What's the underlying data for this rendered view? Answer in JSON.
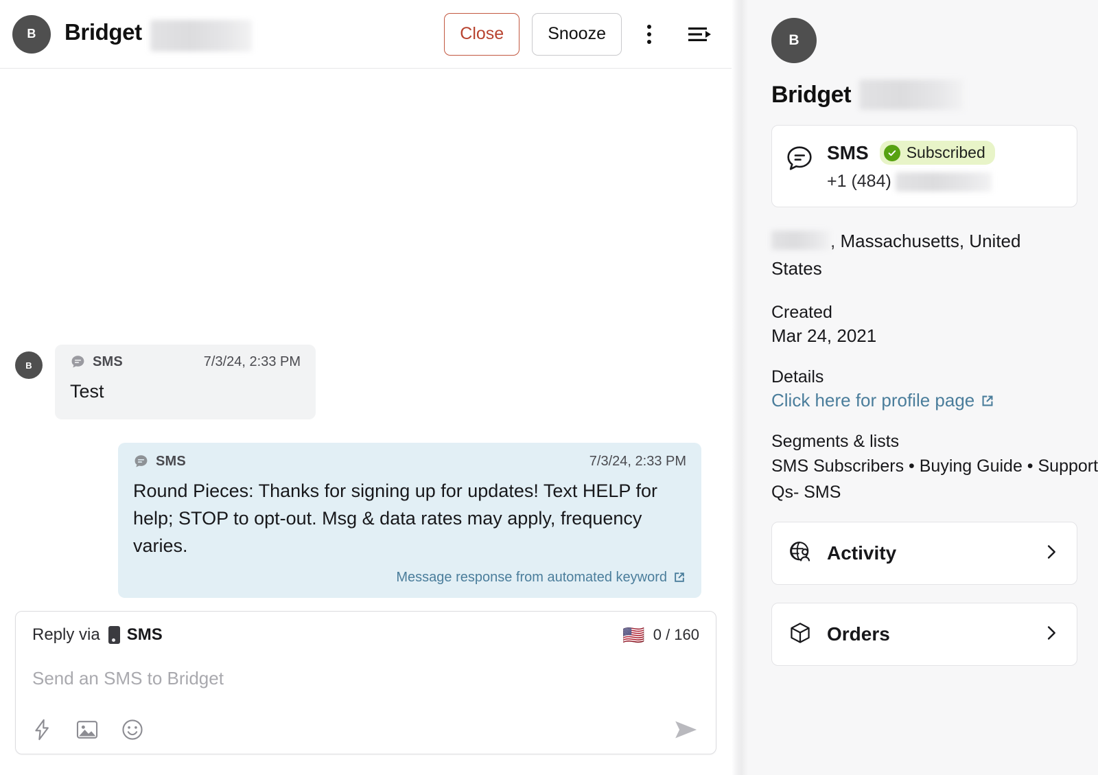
{
  "conversation_header": {
    "avatar_initial": "B",
    "contact_name": "Bridget",
    "close_label": "Close",
    "snooze_label": "Snooze"
  },
  "messages": [
    {
      "direction": "incoming",
      "avatar_initial": "B",
      "channel": "SMS",
      "timestamp": "7/3/24, 2:33 PM",
      "body": "Test"
    },
    {
      "direction": "outgoing",
      "channel": "SMS",
      "timestamp": "7/3/24, 2:33 PM",
      "body": "Round Pieces: Thanks for signing up for updates! Text HELP for help; STOP to opt-out. Msg & data rates may apply, frequency varies.",
      "footnote": "Message response from automated keyword"
    }
  ],
  "composer": {
    "reply_via_label": "Reply via",
    "channel": "SMS",
    "flag": "🇺🇸",
    "character_count": "0 / 160",
    "placeholder": "Send an SMS to Bridget"
  },
  "profile": {
    "avatar_initial": "B",
    "name": "Bridget",
    "channel_card": {
      "channel": "SMS",
      "status_badge": "Subscribed",
      "phone_prefix": "+1 (484)"
    },
    "location": ", Massachusetts, United States",
    "created_label": "Created",
    "created_value": "Mar 24, 2021",
    "details_label": "Details",
    "details_link": "Click here for profile page",
    "segments_label": "Segments & lists",
    "segments_line1": "SMS Subscribers • Buying Guide • Support",
    "segments_line2": "Qs- SMS",
    "nav_items": [
      {
        "label": "Activity",
        "icon": "globe-person-icon"
      },
      {
        "label": "Orders",
        "icon": "box-icon"
      }
    ]
  },
  "colors": {
    "close_accent": "#b8432f",
    "outgoing_bubble": "#e2eff5",
    "incoming_bubble": "#f2f3f4",
    "link": "#4a7d9b",
    "badge_bg": "#e8f4c8",
    "badge_check": "#57a211",
    "avatar_bg": "#4f4f4f"
  }
}
